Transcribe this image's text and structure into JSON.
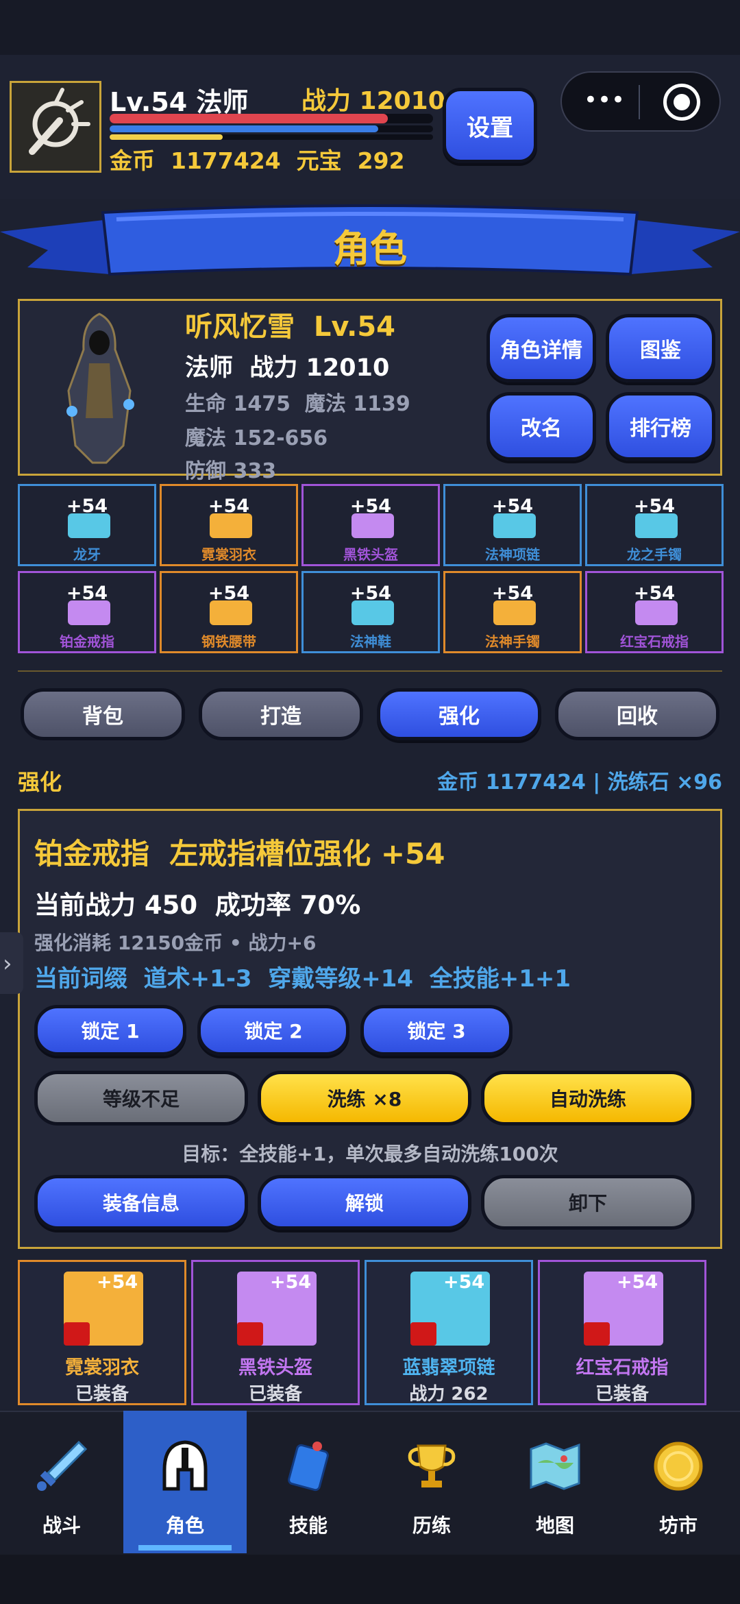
{
  "hud": {
    "level": "Lv.54 法师",
    "power": "战力 12010",
    "currency": "金币  1177424  元宝  292",
    "hp_fill": 0.86,
    "mp_fill": 0.83,
    "xp_fill": 0.35,
    "settings": "设置"
  },
  "banner": {
    "title": "角色"
  },
  "character": {
    "name": "听风忆雪  Lv.54",
    "class_power": "法师  战力 12010",
    "hp_mp": "生命 1475  魔法 1139",
    "magic": "魔法 152-656",
    "defense": "防御 333",
    "buttons": [
      "角色详情",
      "图鉴",
      "改名",
      "排行榜"
    ]
  },
  "slots": [
    {
      "plus": "+54",
      "name": "龙牙",
      "color": "#3f8fd8",
      "icon": "#58c8e6"
    },
    {
      "plus": "+54",
      "name": "霓裳羽衣",
      "color": "#e08a2a",
      "icon": "#f4b03a"
    },
    {
      "plus": "+54",
      "name": "黑铁头盔",
      "color": "#a154d8",
      "icon": "#c48af0"
    },
    {
      "plus": "+54",
      "name": "法神项链",
      "color": "#3f8fd8",
      "icon": "#58c8e6"
    },
    {
      "plus": "+54",
      "name": "龙之手镯",
      "color": "#3f8fd8",
      "icon": "#58c8e6"
    },
    {
      "plus": "+54",
      "name": "铂金戒指",
      "color": "#a154d8",
      "icon": "#c48af0"
    },
    {
      "plus": "+54",
      "name": "钢铁腰带",
      "color": "#e08a2a",
      "icon": "#f4b03a"
    },
    {
      "plus": "+54",
      "name": "法神鞋",
      "color": "#3f8fd8",
      "icon": "#58c8e6"
    },
    {
      "plus": "+54",
      "name": "法神手镯",
      "color": "#e08a2a",
      "icon": "#f4b03a"
    },
    {
      "plus": "+54",
      "name": "红宝石戒指",
      "color": "#a154d8",
      "icon": "#c48af0"
    }
  ],
  "tabs": [
    "背包",
    "打造",
    "强化",
    "回收"
  ],
  "active_tab": "强化",
  "forge": {
    "section": "强化",
    "resources": "金币 1177424 | 洗练石 ×96",
    "title": "铂金戒指  左戒指槽位强化 +54",
    "power_rate": "当前战力 450  成功率 70%",
    "cost": "强化消耗 12150金币 • 战力+6",
    "affix": "当前词缀  道术+1-3  穿戴等级+14  全技能+1+1",
    "locks": [
      "锁定 1",
      "锁定 2",
      "锁定 3"
    ],
    "level_low": "等级不足",
    "reroll": "洗练 ×8",
    "auto_reroll": "自动洗练",
    "target": "目标：全技能+1，单次最多自动洗练100次",
    "equip_info": "装备信息",
    "unlock": "解锁",
    "unequip": "卸下"
  },
  "cards": [
    {
      "plus": "+54",
      "name": "霓裳羽衣",
      "status": "已装备",
      "color": "#e08a2a",
      "name_color": "#f4b03a",
      "thumb": "#f4b03a"
    },
    {
      "plus": "+54",
      "name": "黑铁头盔",
      "status": "已装备",
      "color": "#a154d8",
      "name_color": "#c276f0",
      "thumb": "#c48af0"
    },
    {
      "plus": "+54",
      "name": "蓝翡翠项链",
      "status": "战力 262",
      "color": "#3f8fd8",
      "name_color": "#4fb4f0",
      "thumb": "#58c8e6"
    },
    {
      "plus": "+54",
      "name": "红宝石戒指",
      "status": "已装备",
      "color": "#a154d8",
      "name_color": "#c276f0",
      "thumb": "#c48af0"
    }
  ],
  "nav": [
    {
      "label": "战斗",
      "icon": "sword-icon"
    },
    {
      "label": "角色",
      "icon": "helmet-icon"
    },
    {
      "label": "技能",
      "icon": "skill-book-icon"
    },
    {
      "label": "历练",
      "icon": "trophy-icon"
    },
    {
      "label": "地图",
      "icon": "map-icon"
    },
    {
      "label": "坊市",
      "icon": "coin-icon"
    }
  ],
  "active_nav": "角色"
}
